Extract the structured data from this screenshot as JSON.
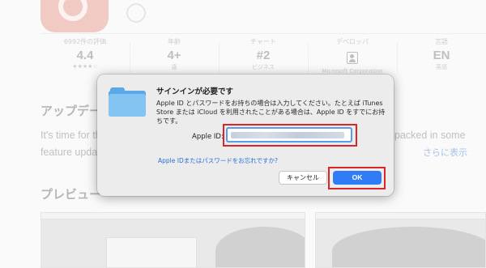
{
  "stats": [
    {
      "header": "6992件の評価",
      "value": "4.4",
      "sub": "★★★★☆"
    },
    {
      "header": "年齢",
      "value": "4+",
      "sub": "歳"
    },
    {
      "header": "チャート",
      "value": "#2",
      "sub": "ビジネス"
    },
    {
      "header": "デベロッパ",
      "value": "",
      "sub": "Microsoft Corporation"
    },
    {
      "header": "言語",
      "value": "EN",
      "sub": "英語"
    }
  ],
  "sections": {
    "update_title": "アップデー",
    "update_text_left": "It's time for th",
    "update_text_right": "packed in some",
    "update_text_line2_left": "feature updat",
    "more_link": "さらに表示",
    "preview_title": "プレビュー"
  },
  "dialog": {
    "title": "サインインが必要です",
    "message": "Apple ID とパスワードをお持ちの場合は入力してください。たとえば iTunes Store または iCloud を利用されたことがある場合は、Apple ID をすでにお持ちです。",
    "field_label": "Apple ID:",
    "field_value": "",
    "forgot_link": "Apple IDまたはパスワードをお忘れですか?",
    "cancel_label": "キャンセル",
    "ok_label": "OK"
  },
  "colors": {
    "highlight_red": "#d8262b",
    "ok_blue": "#2f7cf6",
    "link_blue": "#2a6fd6"
  }
}
